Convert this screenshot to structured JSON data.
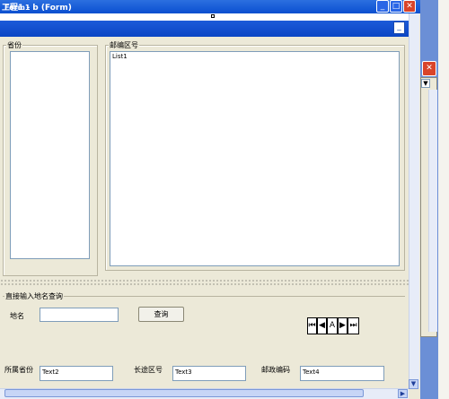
{
  "window": {
    "title": "工程1 - b (Form)"
  },
  "form": {
    "title": "Form1"
  },
  "province_frame": {
    "label": "省份"
  },
  "zip_frame": {
    "label": "邮编区号"
  },
  "list1": {
    "text": "List1"
  },
  "query_frame": {
    "label": "直接输入地名查询"
  },
  "place_label": "地名",
  "query_button": "查询",
  "nav": {
    "first": "⏮",
    "prev": "◀",
    "mid": "A",
    "next": "▶",
    "last": "⏭"
  },
  "fields": {
    "province_label": "所属省份",
    "province_value": "Text2",
    "area_label": "长途区号",
    "area_value": "Text3",
    "zip_label": "邮政编码",
    "zip_value": "Text4"
  },
  "colors": {
    "titlebar": "#0a4fd0",
    "form_bg": "#ece9d8",
    "close": "#d9442a"
  }
}
